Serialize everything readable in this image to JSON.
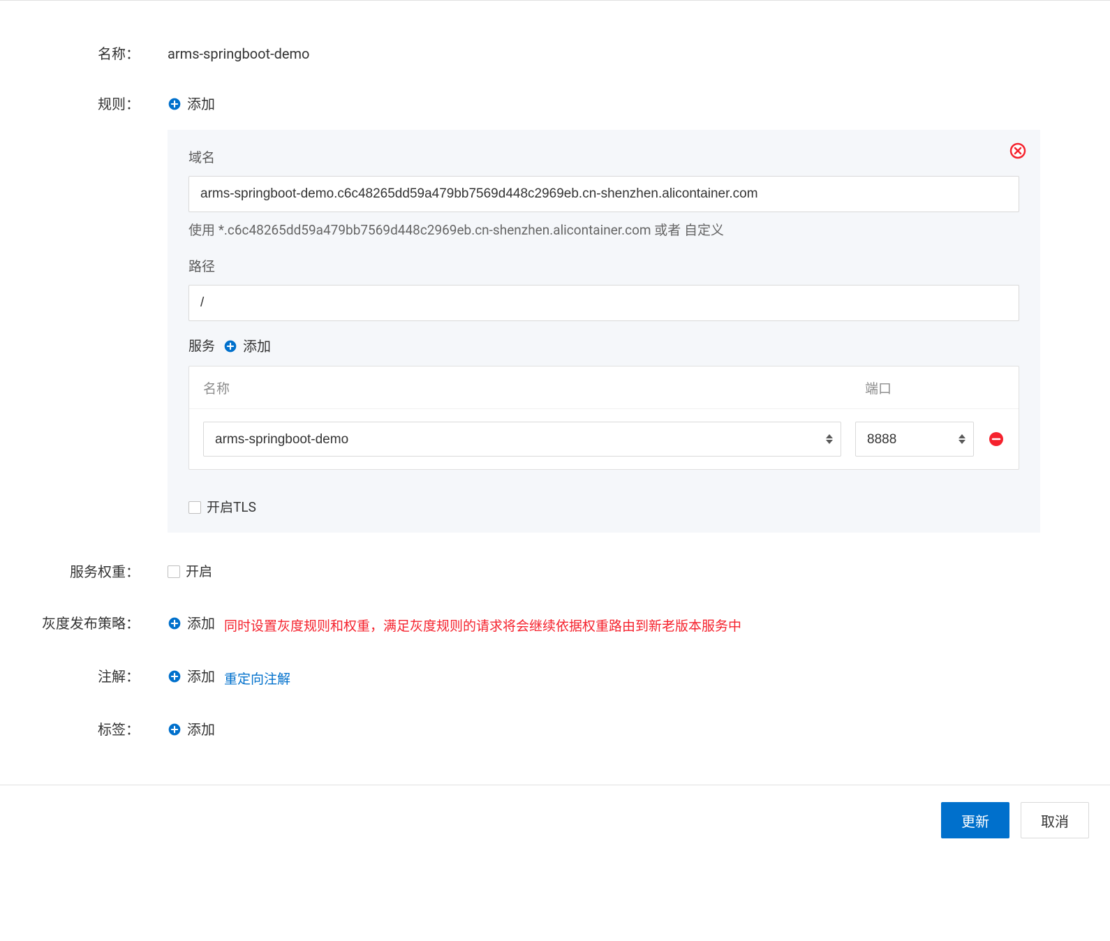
{
  "labels": {
    "name": "名称：",
    "rules": "规则：",
    "service_weight": "服务权重：",
    "gray_release": "灰度发布策略：",
    "annotations": "注解：",
    "tags": "标签："
  },
  "values": {
    "name": "arms-springboot-demo"
  },
  "actions": {
    "add": "添加",
    "update": "更新",
    "cancel": "取消",
    "redirect_annotation": "重定向注解"
  },
  "rule_panel": {
    "domain_label": "域名",
    "domain_value": "arms-springboot-demo.c6c48265dd59a479bb7569d448c2969eb.cn-shenzhen.alicontainer.com",
    "domain_help": "使用 *.c6c48265dd59a479bb7569d448c2969eb.cn-shenzhen.alicontainer.com 或者 自定义",
    "path_label": "路径",
    "path_value": "/",
    "service_label": "服务",
    "service_name_header": "名称",
    "service_port_header": "端口",
    "service_name_value": "arms-springboot-demo",
    "service_port_value": "8888",
    "tls_label": "开启TLS"
  },
  "checkboxes": {
    "enable": "开启"
  },
  "messages": {
    "gray_warning": "同时设置灰度规则和权重，满足灰度规则的请求将会继续依据权重路由到新老版本服务中"
  }
}
